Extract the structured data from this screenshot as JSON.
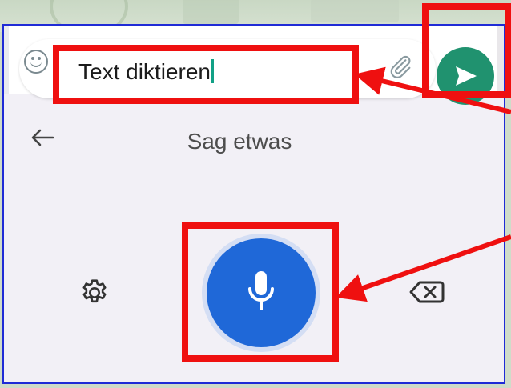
{
  "input": {
    "text": "Text diktieren"
  },
  "voice_panel": {
    "prompt": "Sag etwas"
  },
  "icons": {
    "emoji": "emoji-icon",
    "attach": "paperclip-icon",
    "send": "send-icon",
    "back": "arrow-left-icon",
    "settings": "gear-icon",
    "mic": "microphone-icon",
    "backspace": "backspace-icon"
  },
  "colors": {
    "send": "#20926f",
    "mic": "#1f68d8",
    "annotation": "#ef1010",
    "frame": "#1f2bd6",
    "cursor": "#12a186",
    "panel": "#f2f0f6"
  }
}
